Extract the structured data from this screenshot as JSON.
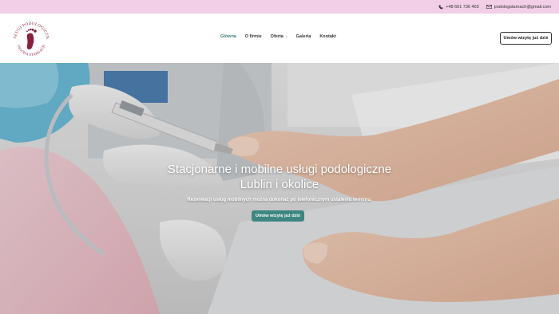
{
  "topbar": {
    "phone": "+48 661 736 403",
    "email": "podologstarnach@gmail.com",
    "background": "#f2cfe6"
  },
  "logo": {
    "top_text": "USŁUGI PODOLOGICZNE",
    "bottom_text": "JAGODA STARNACH",
    "color": "#8a1f3c"
  },
  "nav": {
    "items": [
      {
        "label": "Główna",
        "active": true
      },
      {
        "label": "O firmie",
        "active": false
      },
      {
        "label": "Oferta",
        "active": false,
        "caret": "↓"
      },
      {
        "label": "Galeria",
        "active": false
      },
      {
        "label": "Kontakt",
        "active": false
      }
    ],
    "cta_label": "Umów wizytę już dziś"
  },
  "hero": {
    "title_line1": "Stacjonarne i mobilne usługi podologiczne",
    "title_line2": "Lublin i okolice",
    "subtitle": "Rezerwacji usług mobilnych można dokonać po telefonicznym ustaleniu terminu.",
    "cta_label": "Umów wizytę już dziś",
    "accent": "#3d8682"
  },
  "icons": {
    "phone": "phone-icon",
    "email": "mail-icon"
  }
}
